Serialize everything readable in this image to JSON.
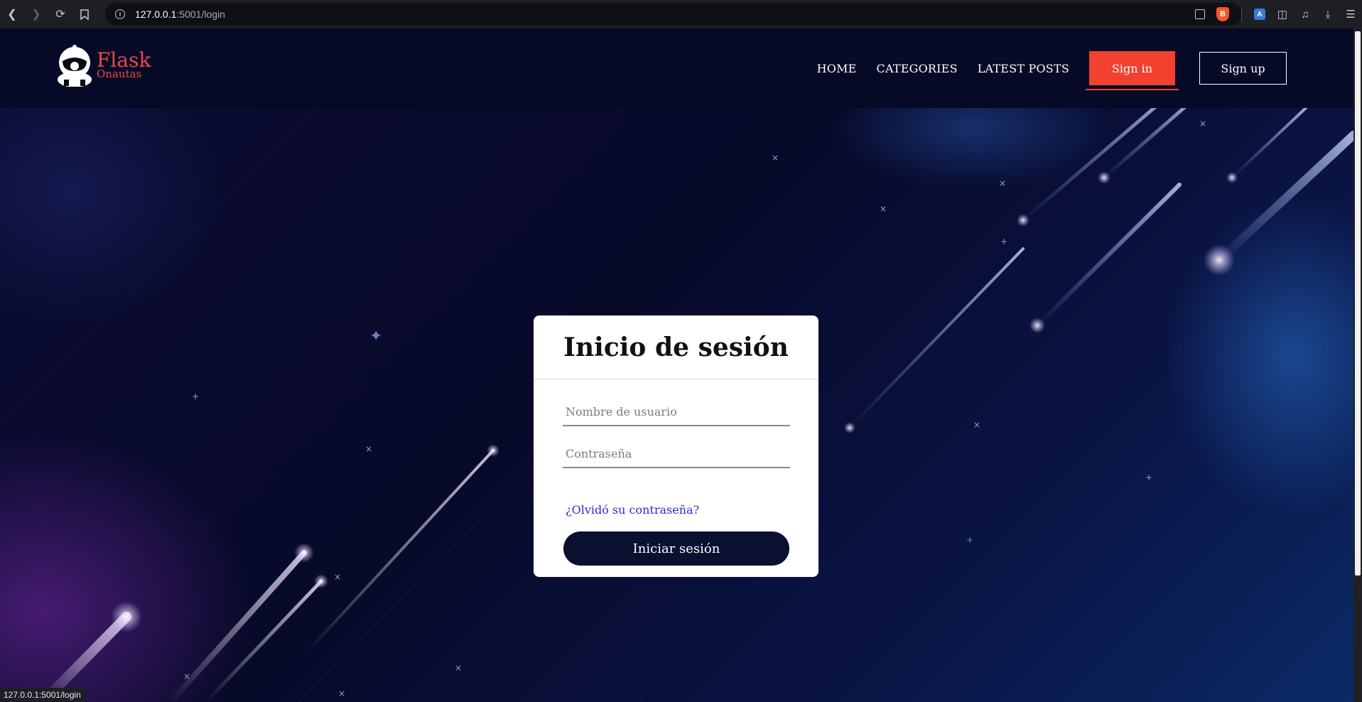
{
  "browser": {
    "url_host": "127.0.0.1",
    "url_path": ":5001/login",
    "status_url": "127.0.0.1:5001/login"
  },
  "site": {
    "logo_title": "Flask",
    "logo_subtitle": "Onautas",
    "nav": {
      "home": "HOME",
      "categories": "CATEGORIES",
      "latest_posts": "LATEST POSTS",
      "sign_in": "Sign in",
      "sign_up": "Sign up"
    }
  },
  "login": {
    "title": "Inicio de sesión",
    "username_placeholder": "Nombre de usuario",
    "username_value": "",
    "password_placeholder": "Contraseña",
    "password_value": "",
    "forgot_link": "¿Olvidó su contraseña?",
    "submit_label": "Iniciar sesión"
  },
  "colors": {
    "accent": "#f2412f",
    "brand": "#e84a4a",
    "header_bg": "#070a26",
    "button_dark": "#0a1030",
    "link": "#2a2ad6"
  },
  "icons": {
    "back": "arrow-left-icon",
    "forward": "arrow-right-icon",
    "reload": "reload-icon",
    "bookmark": "bookmark-icon",
    "site_info": "info-icon",
    "share": "share-icon",
    "brave": "brave-shield-icon",
    "translate": "translate-icon",
    "extensions": "puzzle-icon",
    "media": "music-icon",
    "downloads": "download-icon",
    "menu": "hamburger-menu-icon"
  }
}
